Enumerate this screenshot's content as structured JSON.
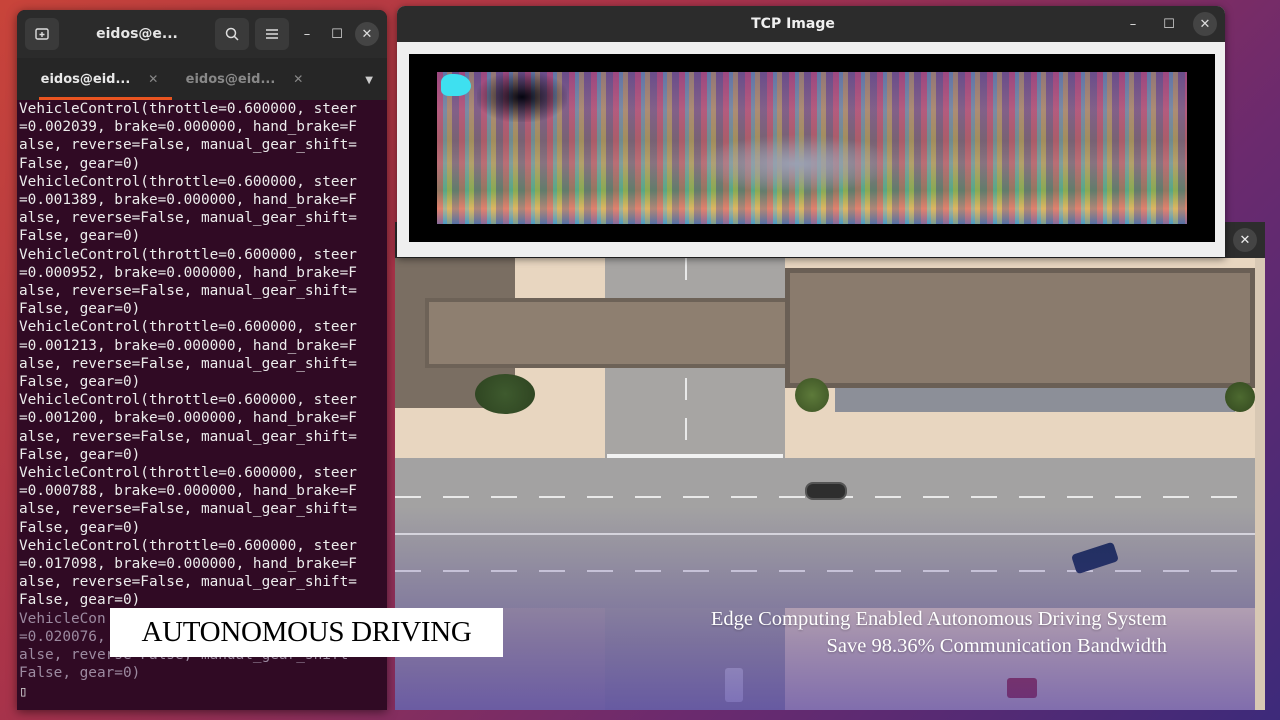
{
  "terminal": {
    "title": "eidos@e...",
    "tabs": [
      {
        "label": "eidos@eid...",
        "active": true
      },
      {
        "label": "eidos@eid...",
        "active": false
      }
    ],
    "lines": [
      "VehicleControl(throttle=0.600000, steer",
      "=0.002039, brake=0.000000, hand_brake=F",
      "alse, reverse=False, manual_gear_shift=",
      "False, gear=0)",
      "VehicleControl(throttle=0.600000, steer",
      "=0.001389, brake=0.000000, hand_brake=F",
      "alse, reverse=False, manual_gear_shift=",
      "False, gear=0)",
      "VehicleControl(throttle=0.600000, steer",
      "=0.000952, brake=0.000000, hand_brake=F",
      "alse, reverse=False, manual_gear_shift=",
      "False, gear=0)",
      "VehicleControl(throttle=0.600000, steer",
      "=0.001213, brake=0.000000, hand_brake=F",
      "alse, reverse=False, manual_gear_shift=",
      "False, gear=0)",
      "VehicleControl(throttle=0.600000, steer",
      "=0.001200, brake=0.000000, hand_brake=F",
      "alse, reverse=False, manual_gear_shift=",
      "False, gear=0)",
      "VehicleControl(throttle=0.600000, steer",
      "=0.000788, brake=0.000000, hand_brake=F",
      "alse, reverse=False, manual_gear_shift=",
      "False, gear=0)",
      "VehicleControl(throttle=0.600000, steer",
      "=0.017098, brake=0.000000, hand_brake=F",
      "alse, reverse=False, manual_gear_shift=",
      "False, gear=0)"
    ],
    "faded_lines": [
      "VehicleCon",
      "=0.020076,",
      "alse, reverse=False, manual_gear_shift=",
      "False, gear=0)"
    ],
    "cursor": "▯"
  },
  "tcp_window": {
    "title": "TCP Image"
  },
  "overlay": {
    "badge": "AUTONOMOUS DRIVING",
    "caption_line1": "Edge Computing Enabled Autonomous Driving System",
    "caption_line2": "Save 98.36% Communication Bandwidth"
  },
  "icons": {
    "new_tab": "new-tab-icon",
    "search": "search-icon",
    "menu": "hamburger-menu-icon",
    "minimize": "minimize-icon",
    "maximize": "maximize-icon",
    "close": "close-icon",
    "tab_dropdown": "chevron-down-icon"
  },
  "colors": {
    "terminal_bg": "#300a24",
    "tab_accent": "#e95420",
    "titlebar": "#2b2b2b"
  }
}
